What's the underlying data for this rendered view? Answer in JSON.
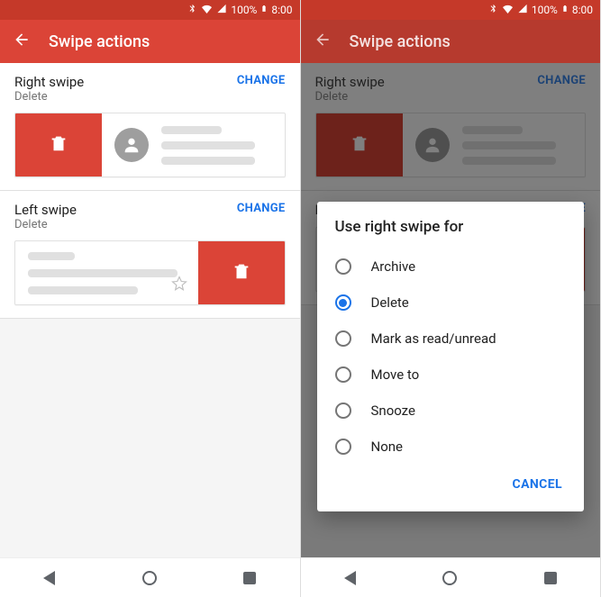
{
  "status": {
    "battery": "100%",
    "time": "8:00"
  },
  "appbar": {
    "title": "Swipe actions"
  },
  "left_screen": {
    "right_swipe": {
      "title": "Right swipe",
      "value": "Delete",
      "change": "CHANGE"
    },
    "left_swipe": {
      "title": "Left swipe",
      "value": "Delete",
      "change": "CHANGE"
    }
  },
  "right_screen": {
    "right_swipe": {
      "title": "Right swipe",
      "value": "Delete",
      "change": "CHANGE"
    },
    "dialog": {
      "title": "Use right swipe for",
      "options": [
        {
          "label": "Archive",
          "selected": false
        },
        {
          "label": "Delete",
          "selected": true
        },
        {
          "label": "Mark as read/unread",
          "selected": false
        },
        {
          "label": "Move to",
          "selected": false
        },
        {
          "label": "Snooze",
          "selected": false
        },
        {
          "label": "None",
          "selected": false
        }
      ],
      "cancel": "CANCEL"
    }
  }
}
